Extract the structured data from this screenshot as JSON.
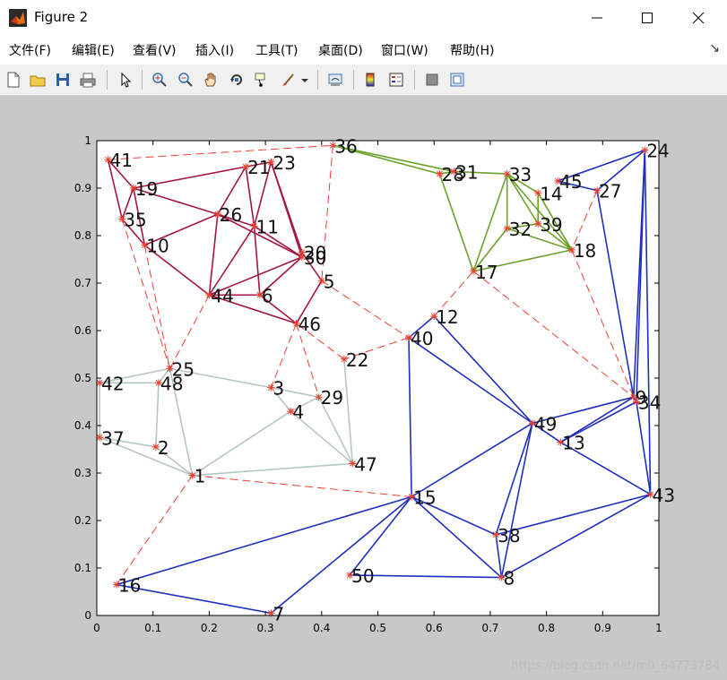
{
  "window": {
    "title": "Figure 2"
  },
  "menu": [
    "文件(F)",
    "编辑(E)",
    "查看(V)",
    "插入(I)",
    "工具(T)",
    "桌面(D)",
    "窗口(W)",
    "帮助(H)"
  ],
  "toolbar": {
    "buttons": [
      "new-figure-icon",
      "open-file-icon",
      "save-icon",
      "print-icon",
      "edit-plot-arrow-icon",
      "zoom-in-icon",
      "zoom-out-icon",
      "pan-hand-icon",
      "rotate-3d-icon",
      "data-cursor-icon",
      "brush-icon",
      "brush-dropdown-icon",
      "link-plot-icon",
      "insert-colorbar-icon",
      "insert-legend-icon",
      "hide-plot-tools-icon",
      "show-plot-tools-icon"
    ]
  },
  "watermark": "https://blog.csdn.net/m0_64773784",
  "chart_data": {
    "type": "scatter",
    "xlim": [
      0,
      1
    ],
    "ylim": [
      0,
      1
    ],
    "xticks": [
      "0",
      "0.1",
      "0.2",
      "0.3",
      "0.4",
      "0.5",
      "0.6",
      "0.7",
      "0.8",
      "0.9",
      "1"
    ],
    "yticks": [
      "0",
      "0.1",
      "0.2",
      "0.3",
      "0.4",
      "0.5",
      "0.6",
      "0.7",
      "0.8",
      "0.9",
      "1"
    ],
    "grid": false,
    "points": [
      {
        "id": "1",
        "x": 0.17,
        "y": 0.295
      },
      {
        "id": "2",
        "x": 0.105,
        "y": 0.355
      },
      {
        "id": "3",
        "x": 0.31,
        "y": 0.48
      },
      {
        "id": "4",
        "x": 0.345,
        "y": 0.43
      },
      {
        "id": "5",
        "x": 0.4,
        "y": 0.705
      },
      {
        "id": "6",
        "x": 0.29,
        "y": 0.675
      },
      {
        "id": "7",
        "x": 0.31,
        "y": 0.005
      },
      {
        "id": "8",
        "x": 0.72,
        "y": 0.08
      },
      {
        "id": "9",
        "x": 0.955,
        "y": 0.46
      },
      {
        "id": "10",
        "x": 0.085,
        "y": 0.78
      },
      {
        "id": "11",
        "x": 0.28,
        "y": 0.82
      },
      {
        "id": "12",
        "x": 0.6,
        "y": 0.63
      },
      {
        "id": "13",
        "x": 0.825,
        "y": 0.365
      },
      {
        "id": "14",
        "x": 0.785,
        "y": 0.89
      },
      {
        "id": "15",
        "x": 0.56,
        "y": 0.25
      },
      {
        "id": "16",
        "x": 0.035,
        "y": 0.065
      },
      {
        "id": "17",
        "x": 0.67,
        "y": 0.725
      },
      {
        "id": "18",
        "x": 0.845,
        "y": 0.77
      },
      {
        "id": "19",
        "x": 0.065,
        "y": 0.9
      },
      {
        "id": "20",
        "x": 0.365,
        "y": 0.765
      },
      {
        "id": "21",
        "x": 0.265,
        "y": 0.945
      },
      {
        "id": "22",
        "x": 0.44,
        "y": 0.54
      },
      {
        "id": "23",
        "x": 0.31,
        "y": 0.955
      },
      {
        "id": "24",
        "x": 0.975,
        "y": 0.98
      },
      {
        "id": "25",
        "x": 0.13,
        "y": 0.52
      },
      {
        "id": "26",
        "x": 0.215,
        "y": 0.845
      },
      {
        "id": "27",
        "x": 0.89,
        "y": 0.895
      },
      {
        "id": "28",
        "x": 0.61,
        "y": 0.93
      },
      {
        "id": "29",
        "x": 0.395,
        "y": 0.46
      },
      {
        "id": "30",
        "x": 0.365,
        "y": 0.755
      },
      {
        "id": "31",
        "x": 0.635,
        "y": 0.935
      },
      {
        "id": "32",
        "x": 0.73,
        "y": 0.815
      },
      {
        "id": "33",
        "x": 0.73,
        "y": 0.93
      },
      {
        "id": "34",
        "x": 0.96,
        "y": 0.45
      },
      {
        "id": "35",
        "x": 0.045,
        "y": 0.835
      },
      {
        "id": "36",
        "x": 0.42,
        "y": 0.99
      },
      {
        "id": "37",
        "x": 0.005,
        "y": 0.375
      },
      {
        "id": "38",
        "x": 0.71,
        "y": 0.17
      },
      {
        "id": "39",
        "x": 0.785,
        "y": 0.825
      },
      {
        "id": "40",
        "x": 0.555,
        "y": 0.585
      },
      {
        "id": "41",
        "x": 0.02,
        "y": 0.96
      },
      {
        "id": "42",
        "x": 0.005,
        "y": 0.49
      },
      {
        "id": "43",
        "x": 0.985,
        "y": 0.255
      },
      {
        "id": "44",
        "x": 0.2,
        "y": 0.675
      },
      {
        "id": "45",
        "x": 0.82,
        "y": 0.915
      },
      {
        "id": "46",
        "x": 0.355,
        "y": 0.615
      },
      {
        "id": "47",
        "x": 0.455,
        "y": 0.32
      },
      {
        "id": "48",
        "x": 0.11,
        "y": 0.49
      },
      {
        "id": "49",
        "x": 0.775,
        "y": 0.405
      },
      {
        "id": "50",
        "x": 0.45,
        "y": 0.085
      }
    ],
    "clusters": [
      {
        "color": "#a3163f",
        "edges": [
          [
            "41",
            "19"
          ],
          [
            "41",
            "35"
          ],
          [
            "19",
            "35"
          ],
          [
            "19",
            "10"
          ],
          [
            "35",
            "10"
          ],
          [
            "19",
            "21"
          ],
          [
            "21",
            "23"
          ],
          [
            "21",
            "26"
          ],
          [
            "26",
            "19"
          ],
          [
            "26",
            "10"
          ],
          [
            "26",
            "44"
          ],
          [
            "26",
            "11"
          ],
          [
            "26",
            "30"
          ],
          [
            "21",
            "11"
          ],
          [
            "23",
            "11"
          ],
          [
            "23",
            "20"
          ],
          [
            "23",
            "30"
          ],
          [
            "11",
            "30"
          ],
          [
            "11",
            "44"
          ],
          [
            "11",
            "6"
          ],
          [
            "10",
            "44"
          ],
          [
            "44",
            "6"
          ],
          [
            "6",
            "30"
          ],
          [
            "44",
            "30"
          ],
          [
            "30",
            "20"
          ],
          [
            "20",
            "5"
          ],
          [
            "5",
            "46"
          ],
          [
            "46",
            "44"
          ],
          [
            "6",
            "46"
          ]
        ]
      },
      {
        "color": "#6aa22a",
        "edges": [
          [
            "36",
            "28"
          ],
          [
            "36",
            "31"
          ],
          [
            "28",
            "31"
          ],
          [
            "31",
            "33"
          ],
          [
            "28",
            "17"
          ],
          [
            "33",
            "17"
          ],
          [
            "33",
            "32"
          ],
          [
            "33",
            "14"
          ],
          [
            "33",
            "18"
          ],
          [
            "33",
            "39"
          ],
          [
            "14",
            "39"
          ],
          [
            "39",
            "18"
          ],
          [
            "14",
            "18"
          ],
          [
            "32",
            "17"
          ],
          [
            "32",
            "39"
          ],
          [
            "32",
            "18"
          ],
          [
            "17",
            "18"
          ]
        ]
      },
      {
        "color": "#1f2fbf",
        "edges": [
          [
            "24",
            "45"
          ],
          [
            "45",
            "27"
          ],
          [
            "24",
            "27"
          ],
          [
            "27",
            "9"
          ],
          [
            "24",
            "9"
          ],
          [
            "24",
            "34"
          ],
          [
            "24",
            "43"
          ],
          [
            "34",
            "43"
          ],
          [
            "9",
            "34"
          ],
          [
            "9",
            "13"
          ],
          [
            "9",
            "49"
          ],
          [
            "34",
            "13"
          ],
          [
            "13",
            "43"
          ],
          [
            "13",
            "49"
          ],
          [
            "49",
            "40"
          ],
          [
            "12",
            "40"
          ],
          [
            "12",
            "49"
          ],
          [
            "40",
            "15"
          ],
          [
            "49",
            "15"
          ],
          [
            "49",
            "38"
          ],
          [
            "49",
            "8"
          ],
          [
            "15",
            "38"
          ],
          [
            "15",
            "8"
          ],
          [
            "15",
            "16"
          ],
          [
            "15",
            "7"
          ],
          [
            "15",
            "50"
          ],
          [
            "38",
            "8"
          ],
          [
            "38",
            "43"
          ],
          [
            "8",
            "43"
          ],
          [
            "50",
            "8"
          ],
          [
            "16",
            "7"
          ]
        ]
      },
      {
        "color": "#b5c7c5",
        "edges": [
          [
            "42",
            "48"
          ],
          [
            "42",
            "25"
          ],
          [
            "42",
            "37"
          ],
          [
            "48",
            "25"
          ],
          [
            "48",
            "2"
          ],
          [
            "37",
            "2"
          ],
          [
            "37",
            "1"
          ],
          [
            "2",
            "1"
          ],
          [
            "25",
            "1"
          ],
          [
            "25",
            "3"
          ],
          [
            "3",
            "29"
          ],
          [
            "3",
            "4"
          ],
          [
            "4",
            "29"
          ],
          [
            "4",
            "1"
          ],
          [
            "29",
            "47"
          ],
          [
            "22",
            "47"
          ],
          [
            "4",
            "47"
          ],
          [
            "1",
            "47"
          ]
        ]
      }
    ],
    "inter_cluster_links": {
      "color": "#e8402f",
      "style": "dashed",
      "edges": [
        [
          "41",
          "36"
        ],
        [
          "35",
          "25"
        ],
        [
          "10",
          "25"
        ],
        [
          "44",
          "25"
        ],
        [
          "36",
          "5"
        ],
        [
          "5",
          "40"
        ],
        [
          "40",
          "22"
        ],
        [
          "22",
          "46"
        ],
        [
          "46",
          "3"
        ],
        [
          "46",
          "29"
        ],
        [
          "12",
          "17"
        ],
        [
          "17",
          "9"
        ],
        [
          "18",
          "9"
        ],
        [
          "27",
          "18"
        ],
        [
          "1",
          "15"
        ],
        [
          "1",
          "16"
        ]
      ]
    }
  }
}
